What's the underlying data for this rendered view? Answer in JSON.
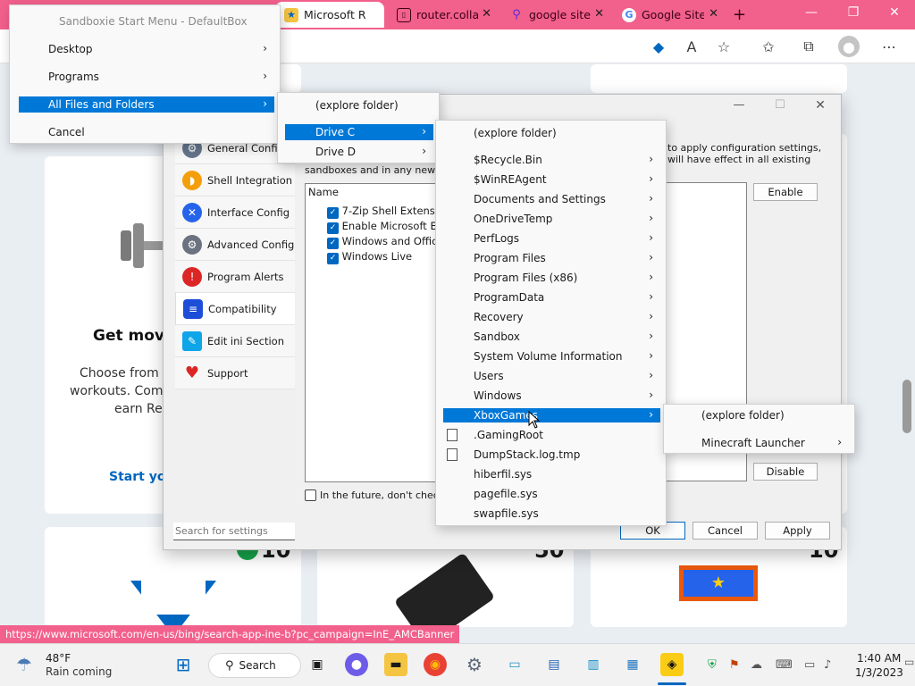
{
  "browser": {
    "tabs": [
      {
        "label": "Microsoft R",
        "active": true
      },
      {
        "label": "router.colla",
        "active": false
      },
      {
        "label": "google site",
        "active": false
      },
      {
        "label": "Google Site",
        "active": false
      }
    ],
    "new_tab": "+"
  },
  "page": {
    "heading": "Get movin",
    "body_lines": [
      "Choose from a",
      "workouts. Comp",
      "earn Rev"
    ],
    "link": "Start you",
    "points": [
      "10",
      "50",
      "10"
    ]
  },
  "status_url": "https://www.microsoft.com/en-us/bing/search-app-ine-b?pc_campaign=InE_AMCBanner",
  "sandboxie_menu": {
    "title": "Sandboxie Start Menu - DefaultBox",
    "items": [
      "Desktop",
      "Programs",
      "All Files and Folders",
      "Cancel"
    ]
  },
  "files_menu": {
    "items": [
      "(explore folder)",
      "Drive C",
      "Drive D"
    ]
  },
  "drive_c_menu": {
    "items": [
      "(explore folder)",
      "$Recycle.Bin",
      "$WinREAgent",
      "Documents and Settings",
      "OneDriveTemp",
      "PerfLogs",
      "Program Files",
      "Program Files (x86)",
      "ProgramData",
      "Recovery",
      "Sandbox",
      "System Volume Information",
      "Users",
      "Windows",
      "XboxGames",
      ".GamingRoot",
      "DumpStack.log.tmp",
      "hiberfil.sys",
      "pagefile.sys",
      "swapfile.sys"
    ]
  },
  "xbox_menu": {
    "items": [
      "(explore folder)",
      "Minecraft Launcher"
    ]
  },
  "dialog": {
    "nav": [
      "General Config",
      "Shell Integration",
      "Interface Config",
      "Advanced Config",
      "Program Alerts",
      "Compatibility",
      "Edit ini Section",
      "Support"
    ],
    "desc_right": [
      "to apply configuration settings,",
      "will have effect in all existing"
    ],
    "desc_left": "sandboxes and in any new san",
    "list_header": "Name",
    "list_items": [
      "7-Zip Shell Extension",
      "Enable Microsoft Ed",
      "Windows and Offic",
      "Windows Live"
    ],
    "enable": "Enable",
    "disable": "Disable",
    "future_check": "In the future, don't check s",
    "search_placeholder": "Search for settings",
    "ok": "OK",
    "cancel": "Cancel",
    "apply": "Apply"
  },
  "taskbar": {
    "weather_temp": "48°F",
    "weather_desc": "Rain coming",
    "search": "Search",
    "time": "1:40 AM",
    "date": "1/3/2023"
  }
}
